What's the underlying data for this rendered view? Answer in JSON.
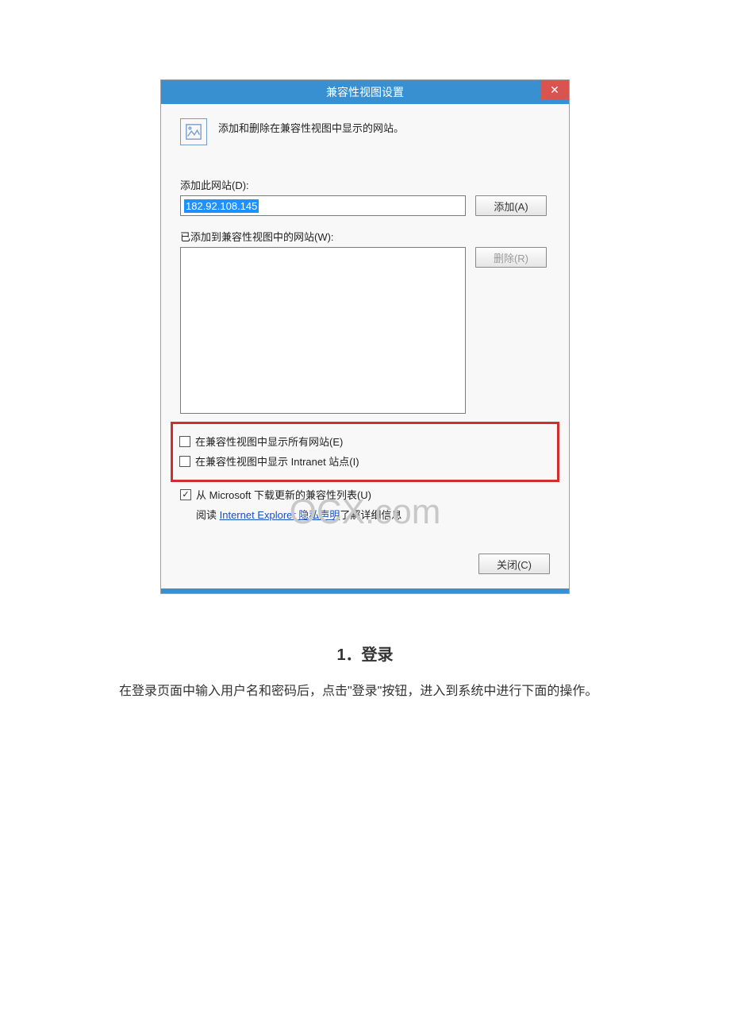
{
  "dialog": {
    "title": "兼容性视图设置",
    "close": "✕",
    "intro": "添加和删除在兼容性视图中显示的网站。",
    "add_label": "添加此网站(D):",
    "input_value": "182.92.108.145",
    "add_btn": "添加(A)",
    "added_label": "已添加到兼容性视图中的网站(W):",
    "remove_btn": "删除(R)",
    "checks": {
      "all_sites": "在兼容性视图中显示所有网站(E)",
      "intranet": "在兼容性视图中显示 Intranet 站点(I)",
      "download": "从 Microsoft 下载更新的兼容性列表(U)"
    },
    "privacy_prefix": "阅读 ",
    "privacy_link": "Internet Explorer 隐私声明",
    "privacy_suffix": "了解详细信息",
    "close_btn": "关闭(C)"
  },
  "watermark": "OCX.com",
  "section": {
    "heading": "1．登录",
    "paragraph": "在登录页面中输入用户名和密码后，点击\"登录\"按钮，进入到系统中进行下面的操作。"
  }
}
